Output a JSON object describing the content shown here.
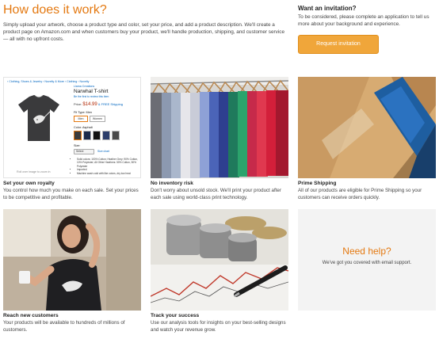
{
  "how": {
    "title": "How does it work?",
    "description": "Simply upload your artwork, choose a product type and color, set your price, and add a product description. We'll create a product page on Amazon.com and when customers buy your product, we'll handle production, shipping, and customer service — all with no upfront costs."
  },
  "invitation": {
    "title": "Want an invitation?",
    "description": "To be considered, please complete an application to tell us more about your background and experience.",
    "button_label": "Request invitation"
  },
  "colors": {
    "accent": "#e47911",
    "button": "#f0a63a",
    "panel_bg": "#f3f3f3"
  },
  "product_page": {
    "breadcrumbs": "‹ Clothing, Shoes & Jewelry › Novelty & More › Clothing › Novelty",
    "brand": "Llama Creations",
    "product_name": "Narwhal T-shirt",
    "by_line": "Be the first to review this item",
    "price_label": "Price:",
    "price": "$14.99",
    "shipping": "& FREE Shipping",
    "fit_label": "Fit Type: Men",
    "fit_options": [
      "Men",
      "Women"
    ],
    "color_label": "Color: Asphalt",
    "size_label": "Size:",
    "size_select": "Select",
    "size_chart": "Size chart",
    "bullets": [
      "Solid colors: 100% Cotton; Heather Grey: 90% Cotton, 10% Polyester; All Other Heathers: 50% Cotton, 50% Polyester",
      "Imported",
      "Machine wash cold with like colors, dry low heat"
    ],
    "zoom_hint": "Roll over image to zoom in",
    "swatch_colors": [
      "#3b3b3b",
      "#1b2a4a",
      "#111111",
      "#2c3e6b",
      "#4a4a4a"
    ]
  },
  "features": [
    {
      "title": "Set your own royalty",
      "description": "You control how much you make on each sale. Set your prices to be competitive and profitable.",
      "image": "product-page"
    },
    {
      "title": "No inventory risk",
      "description": "Don't worry about unsold stock. We'll print your product after each sale using world-class print technology.",
      "image": "clothing-rack"
    },
    {
      "title": "Prime Shipping",
      "description": "All of our products are eligible for Prime Shipping so your customers can receive orders quickly.",
      "image": "prime-box"
    },
    {
      "title": "Reach new customers",
      "description": "Your products will be available to hundreds of millions of customers.",
      "image": "woman-tshirt"
    },
    {
      "title": "Track your success",
      "description": "Use our analysis tools for insights on your best-selling designs and watch your revenue grow.",
      "image": "coins-chart"
    }
  ],
  "help": {
    "title": "Need help?",
    "description": "We've got you covered with email support."
  }
}
